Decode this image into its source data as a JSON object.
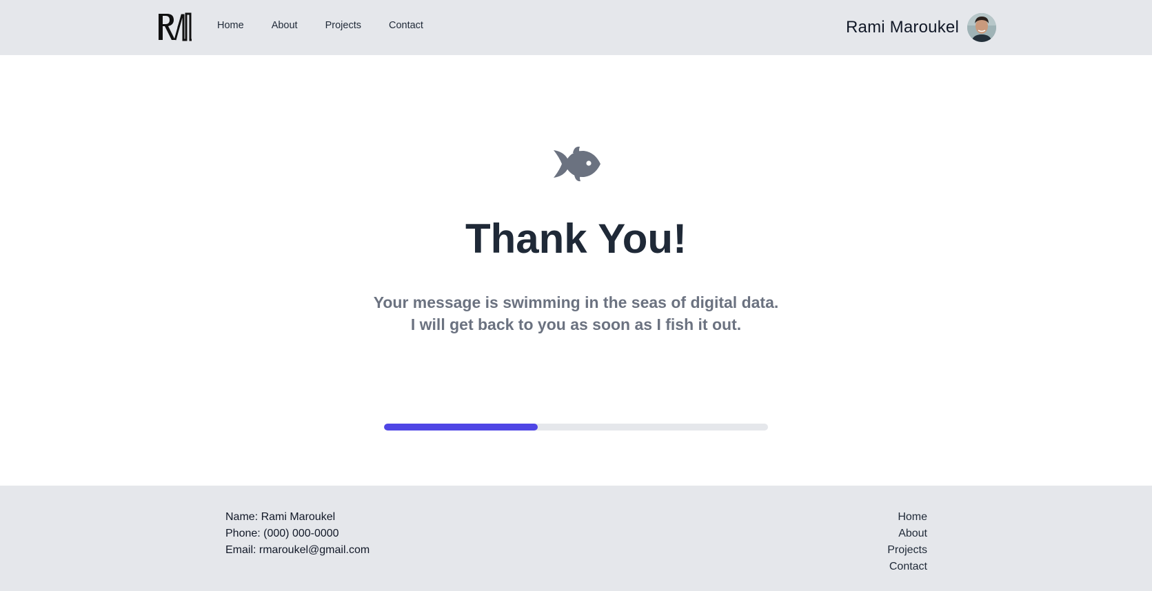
{
  "header": {
    "logo_text": "RM",
    "nav": [
      {
        "label": "Home"
      },
      {
        "label": "About"
      },
      {
        "label": "Projects"
      },
      {
        "label": "Contact"
      }
    ],
    "brand_name": "Rami Maroukel",
    "avatar_icon": "profile-photo"
  },
  "main": {
    "icon": "fish-icon",
    "title": "Thank You!",
    "message_line1": "Your message is swimming in the seas of digital data.",
    "message_line2": "I will get back to you as soon as I fish it out.",
    "progress_fraction": 0.4
  },
  "footer": {
    "name": "Name: Rami Maroukel",
    "phone": "Phone: (000) 000-0000",
    "email": "Email: rmaroukel@gmail.com",
    "links": [
      {
        "label": "Home"
      },
      {
        "label": "About"
      },
      {
        "label": "Projects"
      },
      {
        "label": "Contact"
      }
    ]
  },
  "colors": {
    "header_bg": "#e5e7eb",
    "accent": "#4f46e5",
    "title": "#1f2937",
    "muted": "#6b7280",
    "icon": "#6b7280"
  }
}
